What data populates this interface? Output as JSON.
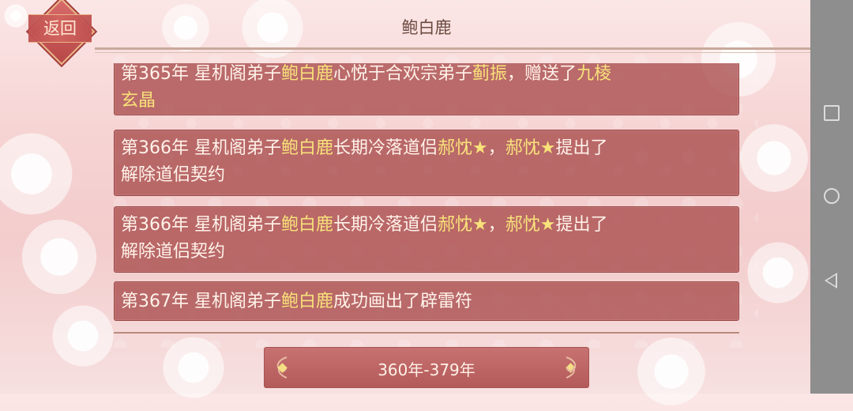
{
  "header": {
    "title": "鲍白鹿",
    "back_label": "返回"
  },
  "events": [
    {
      "lines": [
        [
          {
            "t": "第365年 星机阁弟子"
          },
          {
            "t": "鲍白鹿",
            "hl": true
          },
          {
            "t": "心悦于合欢宗弟子"
          },
          {
            "t": "蓟振",
            "hl": true
          },
          {
            "t": "，赠送了"
          },
          {
            "t": "九棱",
            "hl": true
          }
        ],
        [
          {
            "t": "玄晶",
            "hl": true
          }
        ]
      ]
    },
    {
      "lines": [
        [
          {
            "t": "第366年 星机阁弟子"
          },
          {
            "t": "鲍白鹿",
            "hl": true
          },
          {
            "t": "长期冷落道侣"
          },
          {
            "t": "郝忱★",
            "hl": true
          },
          {
            "t": "，"
          },
          {
            "t": "郝忱★",
            "hl": true
          },
          {
            "t": "提出了"
          }
        ],
        [
          {
            "t": "解除道侣契约"
          }
        ]
      ]
    },
    {
      "lines": [
        [
          {
            "t": "第366年 星机阁弟子"
          },
          {
            "t": "鲍白鹿",
            "hl": true
          },
          {
            "t": "长期冷落道侣"
          },
          {
            "t": "郝忱★",
            "hl": true
          },
          {
            "t": "，"
          },
          {
            "t": "郝忱★",
            "hl": true
          },
          {
            "t": "提出了"
          }
        ],
        [
          {
            "t": "解除道侣契约"
          }
        ]
      ]
    },
    {
      "lines": [
        [
          {
            "t": "第367年 星机阁弟子"
          },
          {
            "t": "鲍白鹿",
            "hl": true
          },
          {
            "t": "成功画出了辟雷符"
          }
        ]
      ]
    }
  ],
  "pager": {
    "label": "360年-379年"
  },
  "colors": {
    "highlight": "#f8e27a",
    "card": "#a84a4a"
  }
}
